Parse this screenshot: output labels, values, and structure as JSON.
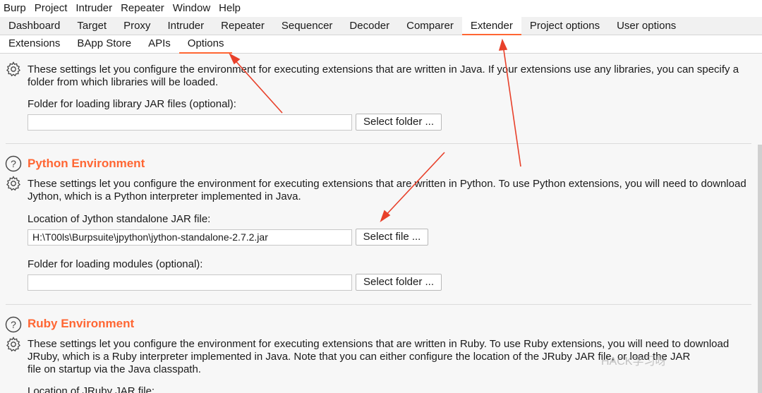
{
  "menu": [
    "Burp",
    "Project",
    "Intruder",
    "Repeater",
    "Window",
    "Help"
  ],
  "main_tabs": [
    "Dashboard",
    "Target",
    "Proxy",
    "Intruder",
    "Repeater",
    "Sequencer",
    "Decoder",
    "Comparer",
    "Extender",
    "Project options",
    "User options"
  ],
  "main_tab_active": "Extender",
  "sub_tabs": [
    "Extensions",
    "BApp Store",
    "APIs",
    "Options"
  ],
  "sub_tab_active": "Options",
  "java": {
    "desc_line1": "These settings let you configure the environment for executing extensions that are written in Java. If your extensions use any libraries, you can specify a",
    "desc_line2": "folder from which libraries will be loaded.",
    "folder_label": "Folder for loading library JAR files (optional):",
    "folder_value": "",
    "folder_button": "Select folder ..."
  },
  "python": {
    "title": "Python Environment",
    "desc_line1": "These settings let you configure the environment for executing extensions that are written in Python. To use Python extensions, you will need to download",
    "desc_line2": "Jython, which is a Python interpreter implemented in Java.",
    "jar_label": "Location of Jython standalone JAR file:",
    "jar_value": "H:\\T00ls\\Burpsuite\\jpython\\jython-standalone-2.7.2.jar",
    "jar_button": "Select file ...",
    "modules_label": "Folder for loading modules (optional):",
    "modules_value": "",
    "modules_button": "Select folder ..."
  },
  "ruby": {
    "title": "Ruby Environment",
    "desc_line1": "These settings let you configure the environment for executing extensions that are written in Ruby. To use Ruby extensions, you will need to download",
    "desc_line2": "JRuby, which is a Ruby interpreter implemented in Java. Note that you can either configure the location of the JRuby JAR file, or load the JAR",
    "desc_line3": "file on startup via the Java classpath.",
    "jar_label": "Location of JRuby JAR file:"
  },
  "watermark": "HACK学习呀",
  "colors": {
    "accent": "#ff6633",
    "annotation_arrow": "#e8402a"
  }
}
